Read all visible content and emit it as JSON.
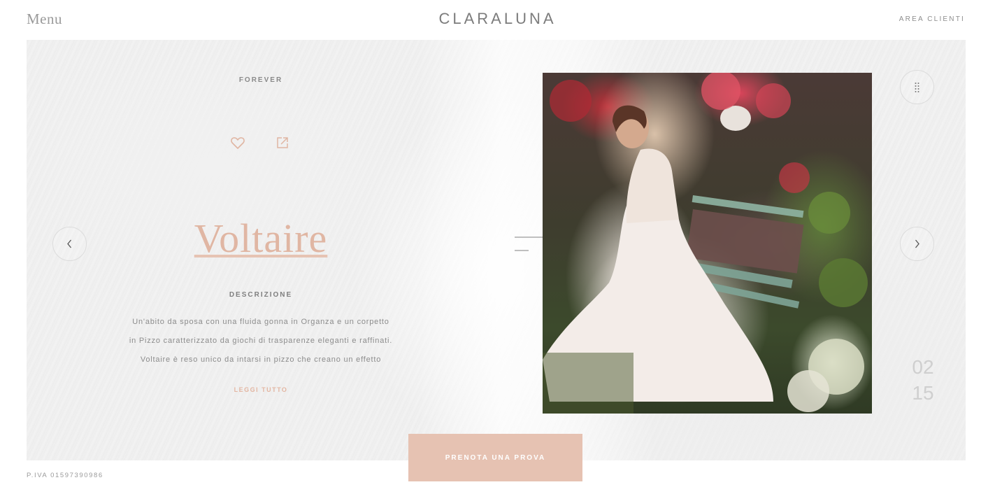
{
  "header": {
    "menu_label": "Menu",
    "logo_text": "CLARALUNA",
    "area_clienti": "AREA CLIENTI"
  },
  "product": {
    "collection": "FOREVER",
    "name": "Voltaire",
    "description_label": "DESCRIZIONE",
    "description_lines": [
      "Un'abito da sposa con una fluida gonna in Organza e un corpetto",
      "in Pizzo caratterizzato da giochi di trasparenze eleganti e raffinati.",
      "Voltaire è reso unico da intarsi in pizzo che creano un effetto"
    ],
    "read_more": "LEGGI TUTTO"
  },
  "slider": {
    "current": "02",
    "total": "15"
  },
  "cta": {
    "label": "PRENOTA UNA PROVA"
  },
  "footer": {
    "vat": "P.IVA 01597390986"
  },
  "icons": {
    "favorite": "heart-icon",
    "share": "external-link-icon",
    "prev": "chevron-left-icon",
    "next": "chevron-right-icon",
    "grid": "dots-grid-icon"
  },
  "colors": {
    "accent": "#e0b6a3",
    "cta_background": "#e6c2b2",
    "text_muted": "#8a8a8a"
  }
}
